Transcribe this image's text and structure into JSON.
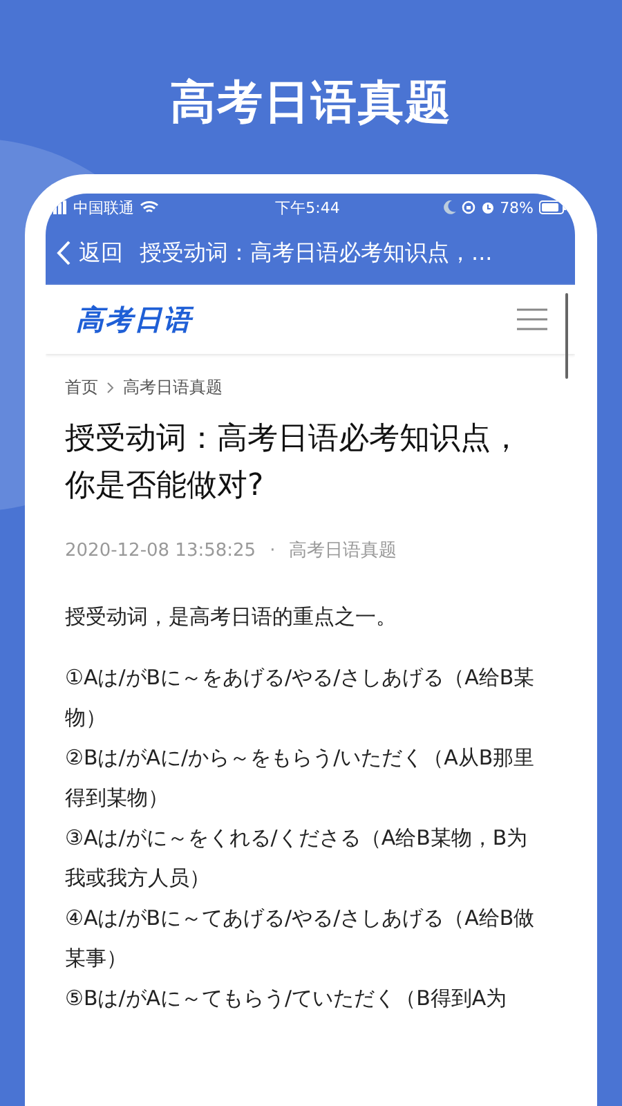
{
  "headline": "高考日语真题",
  "status_bar": {
    "carrier": "中国联通",
    "time": "下午5:44",
    "battery": "78%"
  },
  "nav": {
    "back": "返回",
    "title": "授受动词：高考日语必考知识点，..."
  },
  "site": {
    "logo": "高考日语"
  },
  "breadcrumb": [
    "首页",
    "高考日语真题"
  ],
  "article": {
    "title": "授受动词：高考日语必考知识点，你是否能做对?",
    "date": "2020-12-08 13:58:25",
    "separator": "·",
    "category": "高考日语真题",
    "intro": "授受动词，是高考日语的重点之一。",
    "items": [
      "①Aは/がBに～をあげる/やる/さしあげる（A给B某物）",
      "②Bは/がAに/から～をもらう/いただく（A从B那里得到某物）",
      "③Aは/がに～をくれる/くださる（A给B某物，B为我或我方人员）",
      "④Aは/がBに～てあげる/やる/さしあげる（A给B做某事）",
      "⑤Bは/がAに～てもらう/ていただく（B得到A为"
    ]
  }
}
